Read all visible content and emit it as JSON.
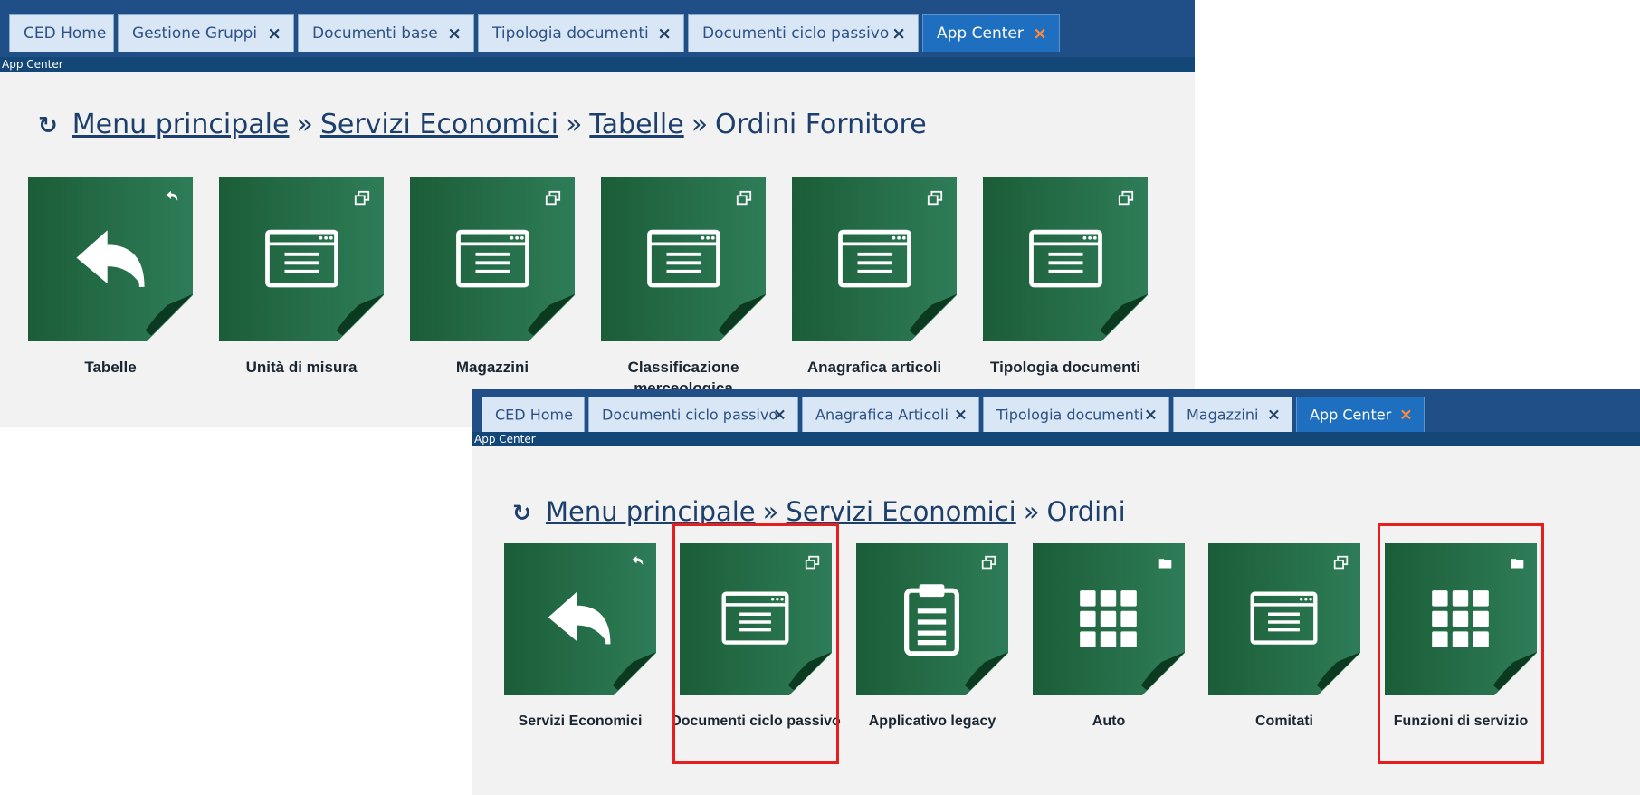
{
  "panel_top": {
    "tabs": [
      {
        "label": "CED Home",
        "closable": false,
        "active": false
      },
      {
        "label": "Gestione Gruppi",
        "closable": true,
        "active": false
      },
      {
        "label": "Documenti base",
        "closable": true,
        "active": false
      },
      {
        "label": "Tipologia documenti",
        "closable": true,
        "active": false
      },
      {
        "label": "Documenti ciclo passivo",
        "closable": true,
        "active": false
      },
      {
        "label": "App Center",
        "closable": true,
        "active": true
      }
    ],
    "close_glyph": "×",
    "subheader": "App Center",
    "breadcrumb": {
      "refresh_glyph": "↻",
      "items": [
        "Menu principale",
        "Servizi Economici",
        "Tabelle"
      ],
      "current": "Ordini Fornitore",
      "separator": "»"
    },
    "tiles": [
      {
        "label": "Tabelle",
        "icon": "back-arrow-icon",
        "corner": "reply-icon"
      },
      {
        "label": "Unità di misura",
        "icon": "window-list-icon",
        "corner": "window-restore-icon"
      },
      {
        "label": "Magazzini",
        "icon": "window-list-icon",
        "corner": "window-restore-icon"
      },
      {
        "label": "Classificazione merceologica",
        "icon": "window-list-icon",
        "corner": "window-restore-icon"
      },
      {
        "label": "Anagrafica articoli",
        "icon": "window-list-icon",
        "corner": "window-restore-icon"
      },
      {
        "label": "Tipologia documenti",
        "icon": "window-list-icon",
        "corner": "window-restore-icon"
      }
    ]
  },
  "panel_bottom": {
    "tabs": [
      {
        "label": "CED Home",
        "closable": false,
        "active": false
      },
      {
        "label": "Documenti ciclo passivo",
        "closable": true,
        "active": false
      },
      {
        "label": "Anagrafica Articoli",
        "closable": true,
        "active": false
      },
      {
        "label": "Tipologia documenti",
        "closable": true,
        "active": false
      },
      {
        "label": "Magazzini",
        "closable": true,
        "active": false
      },
      {
        "label": "App Center",
        "closable": true,
        "active": true
      }
    ],
    "close_glyph": "×",
    "subheader": "App Center",
    "breadcrumb": {
      "refresh_glyph": "↻",
      "items": [
        "Menu principale",
        "Servizi Economici"
      ],
      "current": "Ordini",
      "separator": "»"
    },
    "tiles": [
      {
        "label": "Servizi Economici",
        "icon": "back-arrow-icon",
        "corner": "reply-icon",
        "highlighted": false
      },
      {
        "label": "Documenti ciclo passivo",
        "icon": "window-list-icon",
        "corner": "window-restore-icon",
        "highlighted": true
      },
      {
        "label": "Applicativo legacy",
        "icon": "clipboard-icon",
        "corner": "window-restore-icon",
        "highlighted": false
      },
      {
        "label": "Auto",
        "icon": "grid-apps-icon",
        "corner": "folder-icon",
        "highlighted": false
      },
      {
        "label": "Comitati",
        "icon": "window-list-icon",
        "corner": "window-restore-icon",
        "highlighted": false
      },
      {
        "label": "Funzioni di servizio",
        "icon": "grid-apps-icon",
        "corner": "folder-icon",
        "highlighted": true
      }
    ]
  },
  "colors": {
    "tabbar": "#1f4f86",
    "tab": "#d9e6f5",
    "tab_active": "#1e6fbf",
    "tile_dark": "#1b5d38",
    "tile_light": "#2e7d58",
    "highlight": "#e51e1e",
    "breadcrumb": "#1d3f6b"
  }
}
